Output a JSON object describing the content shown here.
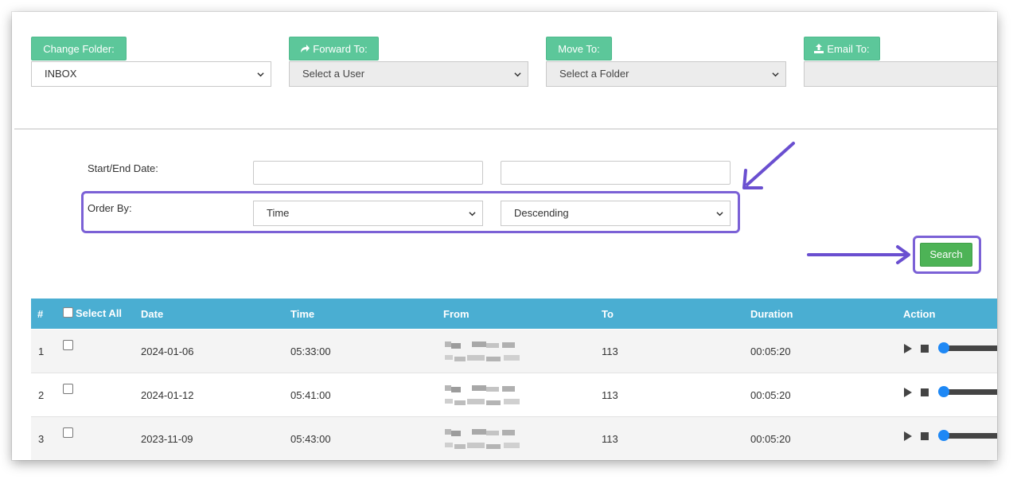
{
  "toolbar": {
    "change_folder_label": "Change Folder:",
    "forward_to_label": "Forward To:",
    "move_to_label": "Move To:",
    "email_to_label": "Email To:",
    "folder_select_value": "INBOX",
    "user_select_placeholder": "Select a User",
    "move_folder_placeholder": "Select a Folder",
    "email_value": ""
  },
  "filters": {
    "date_label": "Start/End Date:",
    "start_date": "",
    "end_date": "",
    "order_label": "Order By:",
    "order_field": "Time",
    "order_direction": "Descending",
    "search_label": "Search"
  },
  "table": {
    "columns": [
      "#",
      "Select All",
      "Date",
      "Time",
      "From",
      "To",
      "Duration",
      "Action"
    ],
    "rows": [
      {
        "num": "1",
        "date": "2024-01-06",
        "time": "05:33:00",
        "from": "",
        "to": "113",
        "duration": "00:05:20"
      },
      {
        "num": "2",
        "date": "2024-01-12",
        "time": "05:41:00",
        "from": "",
        "to": "113",
        "duration": "00:05:20"
      },
      {
        "num": "3",
        "date": "2023-11-09",
        "time": "05:43:00",
        "from": "",
        "to": "113",
        "duration": "00:05:20"
      }
    ]
  },
  "colors": {
    "header_green": "#5cc79a",
    "search_green": "#4db356",
    "table_header_blue": "#4aaed2",
    "annotation_purple": "#7b61d6",
    "slider_blue": "#1e88f5"
  }
}
